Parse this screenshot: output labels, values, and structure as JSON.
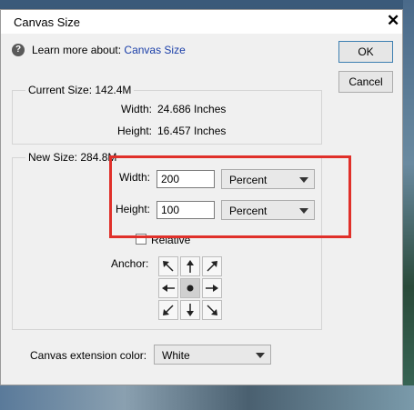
{
  "dialog": {
    "title": "Canvas Size",
    "help_text": "Learn more about:",
    "help_link": "Canvas Size",
    "ok_label": "OK",
    "cancel_label": "Cancel"
  },
  "current_size": {
    "legend": "Current Size: 142.4M",
    "width_label": "Width:",
    "width_value": "24.686 Inches",
    "height_label": "Height:",
    "height_value": "16.457 Inches"
  },
  "new_size": {
    "legend": "New Size: 284.8M",
    "width_label": "Width:",
    "width_value": "200",
    "width_unit": "Percent",
    "height_label": "Height:",
    "height_value": "100",
    "height_unit": "Percent",
    "relative_label": "Relative",
    "relative_checked": false,
    "anchor_label": "Anchor:",
    "anchor_icons": [
      "arrow-nw-icon",
      "arrow-n-icon",
      "arrow-ne-icon",
      "arrow-w-icon",
      "anchor-dot-icon",
      "arrow-e-icon",
      "arrow-sw-icon",
      "arrow-s-icon",
      "arrow-se-icon"
    ]
  },
  "extension": {
    "label": "Canvas extension color:",
    "value": "White"
  },
  "colors": {
    "highlight": "#e0302a",
    "link": "#1a3ea8"
  }
}
